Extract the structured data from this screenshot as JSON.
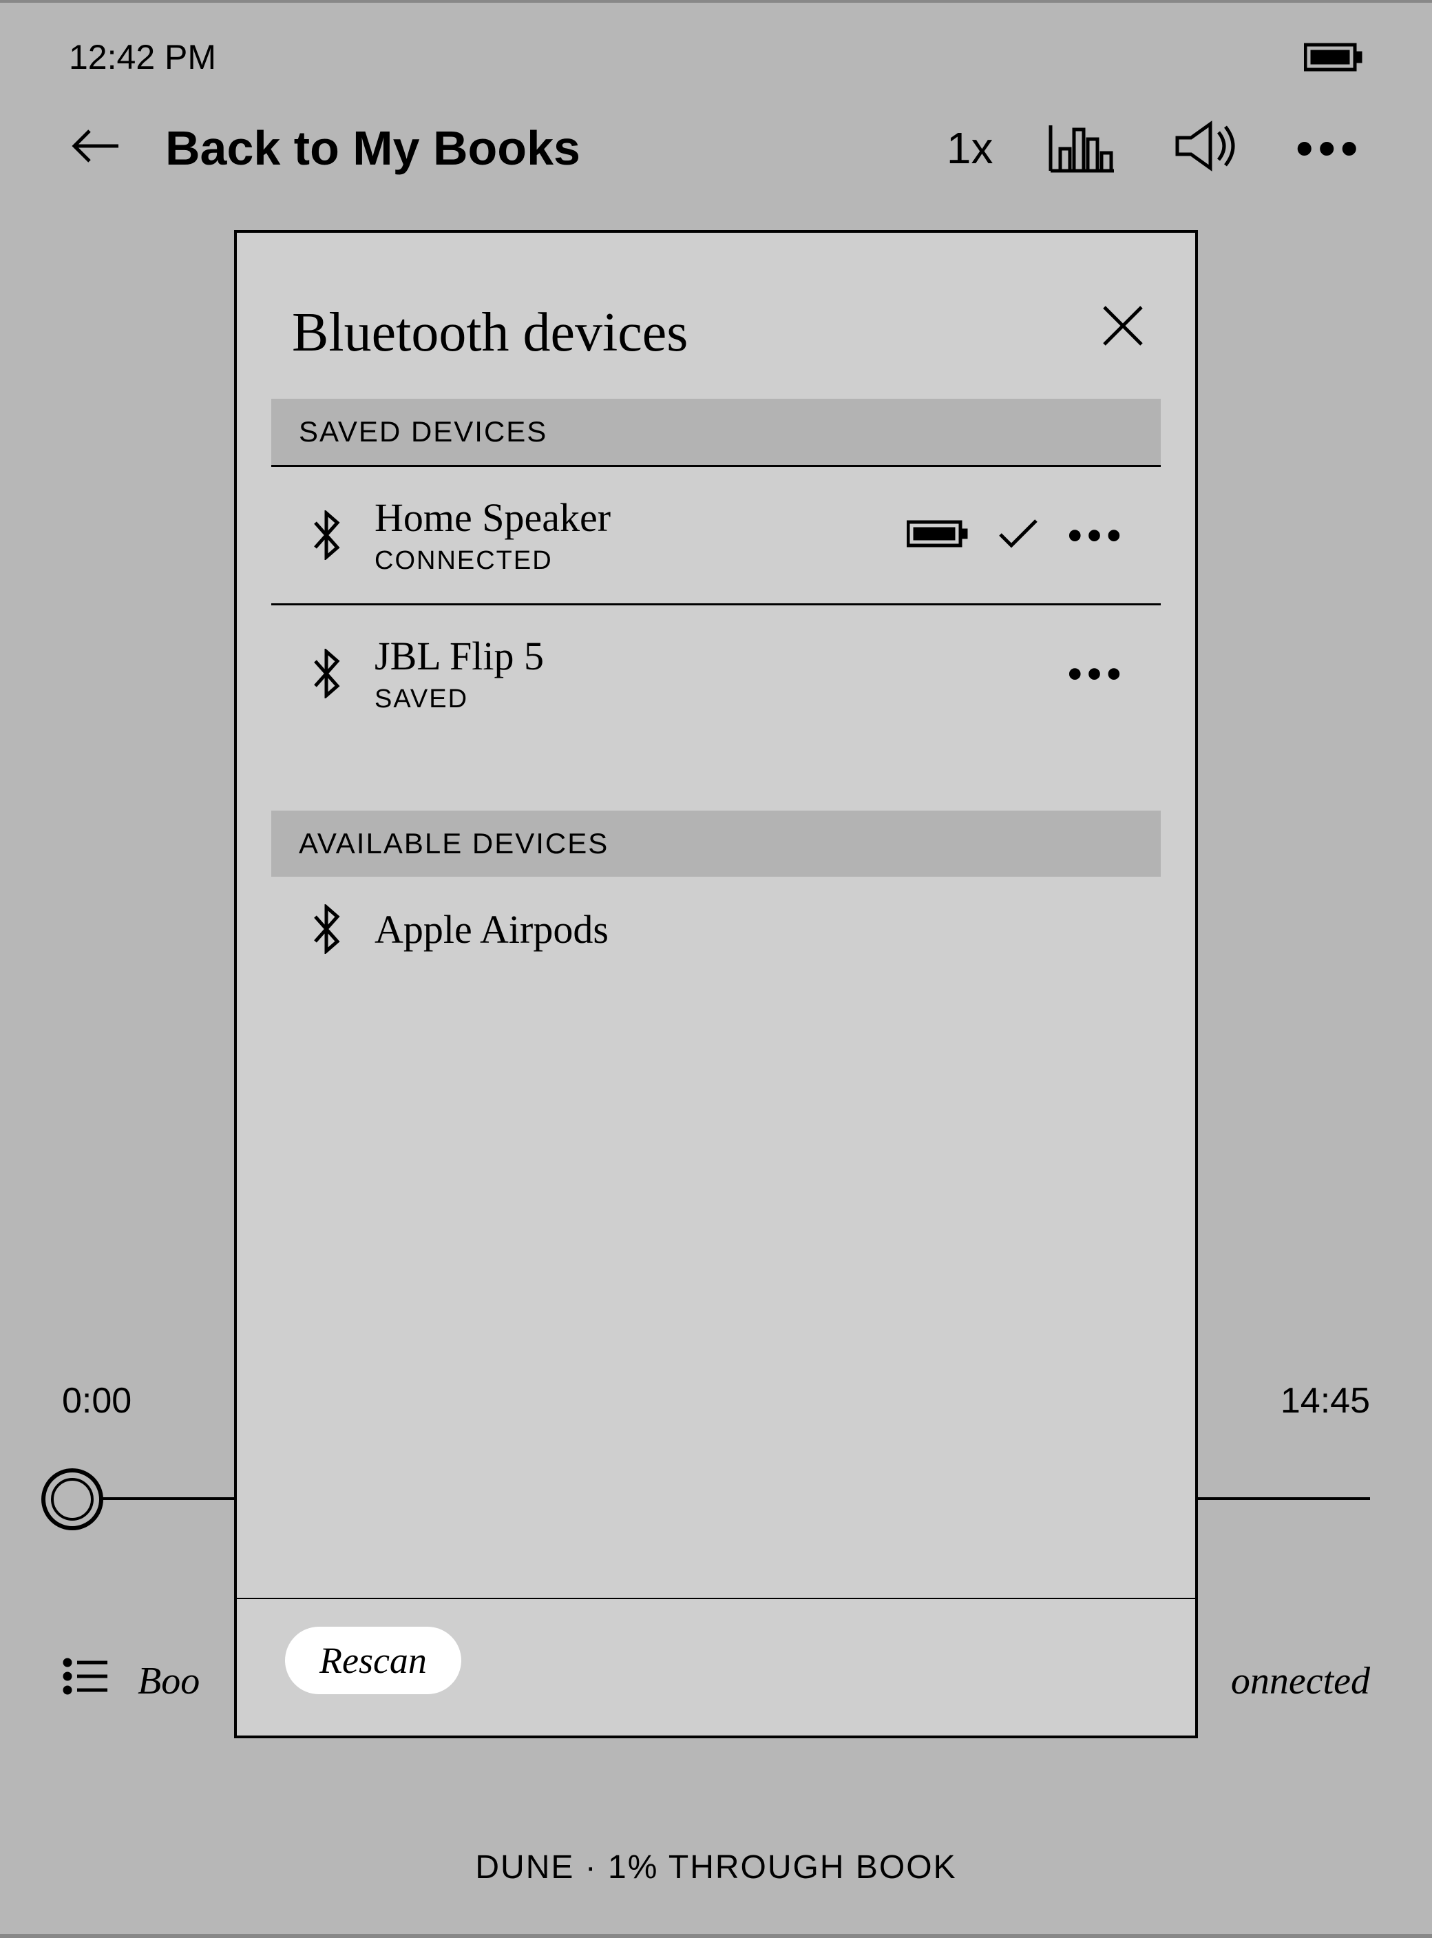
{
  "status": {
    "time": "12:42 PM"
  },
  "nav": {
    "back_label": "Back to My Books",
    "speed": "1x"
  },
  "player": {
    "elapsed": "0:00",
    "remaining": "14:45"
  },
  "bottom": {
    "left_partial": "Boo",
    "right_partial": "onnected"
  },
  "progress": {
    "line": "DUNE · 1% THROUGH BOOK"
  },
  "modal": {
    "title": "Bluetooth devices",
    "saved_header": "SAVED DEVICES",
    "available_header": "AVAILABLE DEVICES",
    "rescan": "Rescan",
    "saved": [
      {
        "name": "Home Speaker",
        "status": "CONNECTED"
      },
      {
        "name": "JBL Flip 5",
        "status": "SAVED"
      }
    ],
    "available": [
      {
        "name": "Apple Airpods"
      }
    ]
  }
}
